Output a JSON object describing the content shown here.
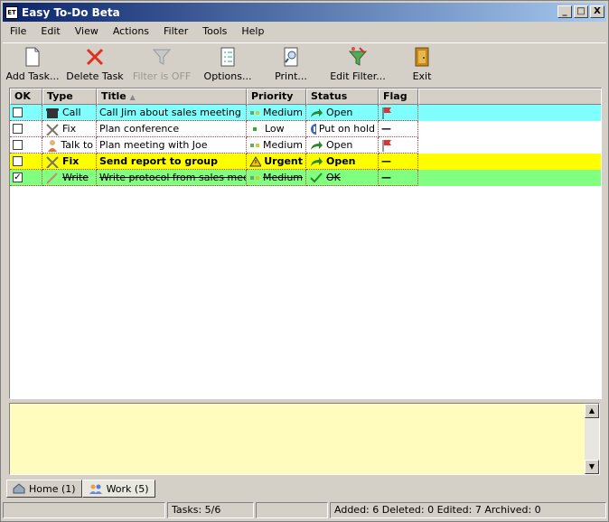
{
  "window": {
    "title": "Easy To-Do Beta",
    "app_icon": "ET",
    "controls": [
      "_",
      "□",
      "X"
    ]
  },
  "menu": [
    "File",
    "Edit",
    "View",
    "Actions",
    "Filter",
    "Tools",
    "Help"
  ],
  "toolbar": [
    {
      "label": "Add Task...",
      "icon": "new-document-icon",
      "enabled": true
    },
    {
      "label": "Delete Task",
      "icon": "delete-x-icon",
      "enabled": true
    },
    {
      "label": "Filter is OFF",
      "icon": "funnel-icon",
      "enabled": false
    },
    {
      "label": "Options...",
      "icon": "checklist-icon",
      "enabled": true
    },
    {
      "label": "Print...",
      "icon": "print-preview-icon",
      "enabled": true
    },
    {
      "label": "Edit Filter...",
      "icon": "funnel-edit-icon",
      "enabled": true
    },
    {
      "label": "Exit",
      "icon": "exit-door-icon",
      "enabled": true
    }
  ],
  "grid": {
    "columns": [
      "OK",
      "Type",
      "Title",
      "Priority",
      "Status",
      "Flag"
    ],
    "sort_indicator": "▲",
    "rows": [
      {
        "ok": false,
        "type": "Call",
        "title": "Call Jim about sales meeting",
        "priority": "Medium",
        "status": "Open",
        "flag": "red-flag",
        "bg": "#80ffff",
        "bold": false,
        "strike": false
      },
      {
        "ok": false,
        "type": "Fix",
        "title": "Plan conference",
        "priority": "Low",
        "status": "Put on hold",
        "flag": "—",
        "bg": "#ffffff",
        "bold": false,
        "strike": false
      },
      {
        "ok": false,
        "type": "Talk to",
        "title": "Plan meeting with Joe",
        "priority": "Medium",
        "status": "Open",
        "flag": "red-flag",
        "bg": "#ffffff",
        "bold": false,
        "strike": false
      },
      {
        "ok": false,
        "type": "Fix",
        "title": "Send report to group",
        "priority": "Urgent",
        "status": "Open",
        "flag": "—",
        "bg": "#ffff00",
        "bold": true,
        "strike": false
      },
      {
        "ok": true,
        "type": "Write",
        "title": "Write protocol from sales meeting",
        "priority": "Medium",
        "status": "OK",
        "flag": "—",
        "bg": "#80ff80",
        "bold": false,
        "strike": true
      }
    ]
  },
  "tabs": [
    {
      "label": "Home (1)",
      "active": false
    },
    {
      "label": "Work (5)",
      "active": true
    }
  ],
  "status": {
    "tasks": "Tasks: 5/6",
    "summary": "Added: 6 Deleted: 0 Edited: 7 Archived: 0"
  }
}
